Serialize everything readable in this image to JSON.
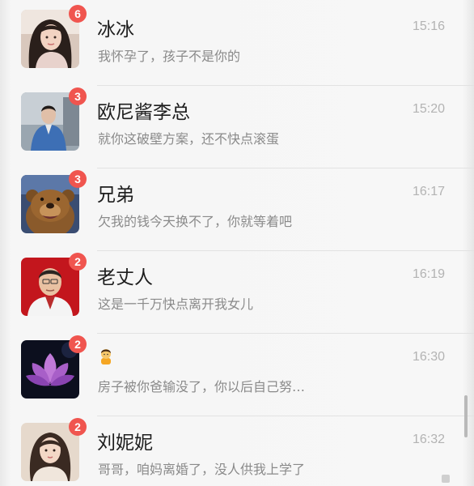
{
  "chats": [
    {
      "name": "冰冰",
      "message": "我怀孕了，孩子不是你的",
      "time": "15:16",
      "unread": "6",
      "avatar": "woman-portrait"
    },
    {
      "name": "欧尼酱李总",
      "message": "就你这破壁方案，还不快点滚蛋",
      "time": "15:20",
      "unread": "3",
      "avatar": "man-photo"
    },
    {
      "name": "兄弟",
      "message": "欠我的钱今天换不了，你就等着吧",
      "time": "16:17",
      "unread": "3",
      "avatar": "bear-cartoon"
    },
    {
      "name": "老丈人",
      "message": "这是一千万快点离开我女儿",
      "time": "16:19",
      "unread": "2",
      "avatar": "older-man-portrait"
    },
    {
      "name": "",
      "message": "房子被你爸输没了，你以后自己努…",
      "time": "16:30",
      "unread": "2",
      "avatar": "lotus-flower",
      "name_icon": "person-emoji"
    },
    {
      "name": "刘妮妮",
      "message": "哥哥，咱妈离婚了，没人供我上学了",
      "time": "16:32",
      "unread": "2",
      "avatar": "girl-portrait"
    }
  ],
  "colors": {
    "badge": "#f0554f",
    "name": "#1d1d1d",
    "message": "#8a8a8a",
    "time": "#b3b3b3"
  }
}
